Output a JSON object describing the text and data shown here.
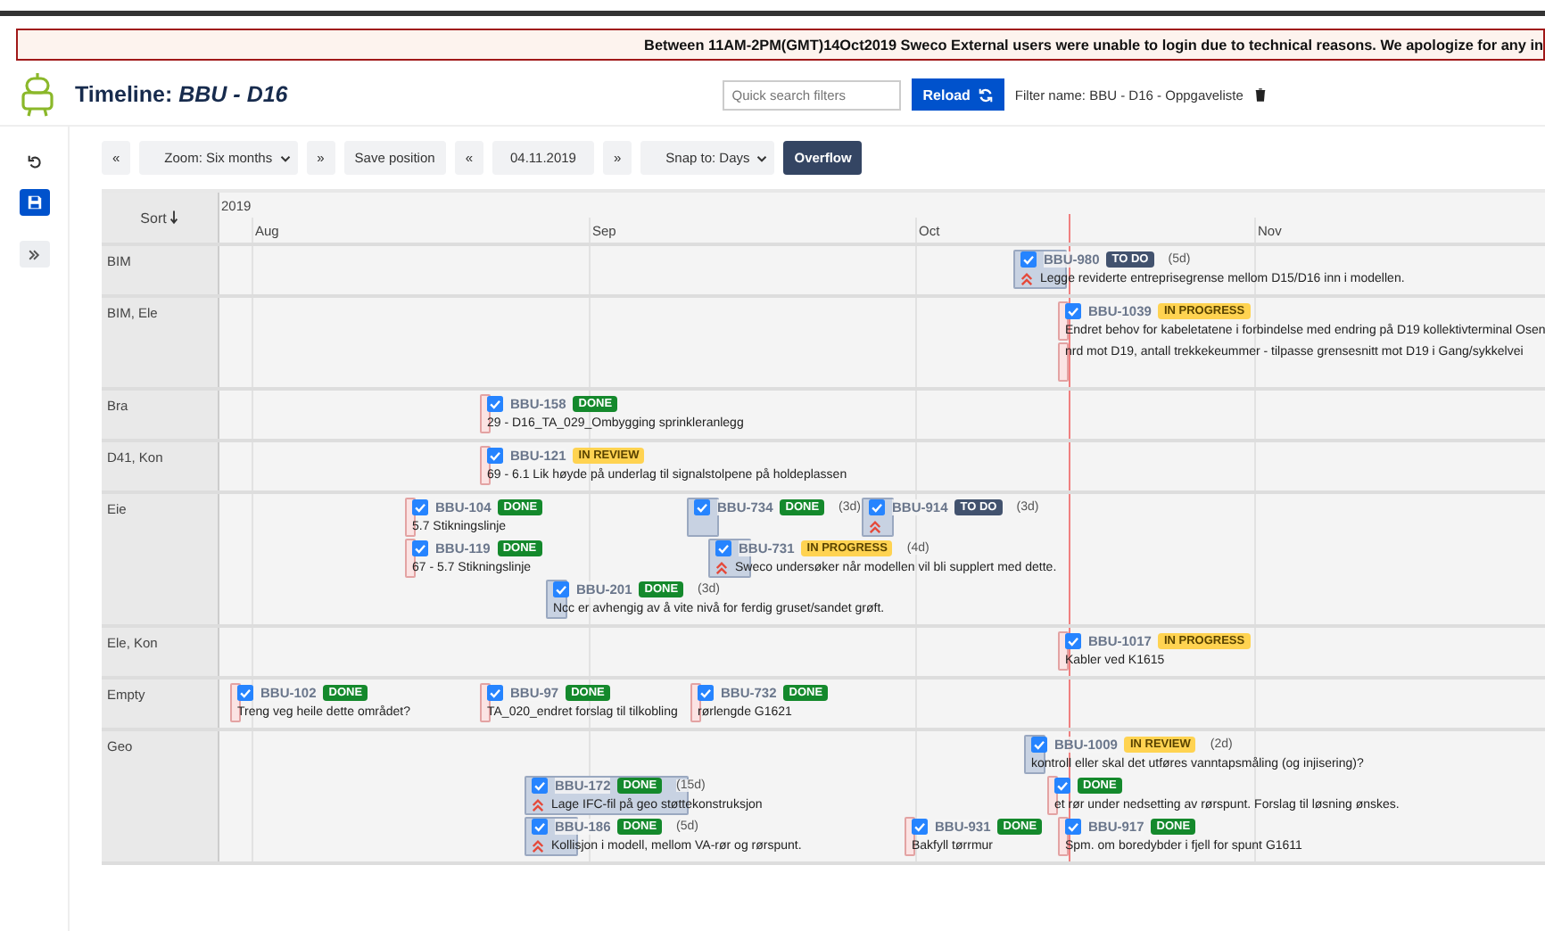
{
  "banner": {
    "text": "Between 11AM-2PM(GMT)14Oct2019 Sweco External users were unable to login due to technical reasons. We apologize for any in"
  },
  "header": {
    "title": "Timeline: *BBU - D16*",
    "search": {
      "placeholder": "Quick search filters"
    },
    "reload": "Reload",
    "filter_name": "Filter name: BBU - D16 - Oppgaveliste"
  },
  "toolbar": [
    {
      "kind": "button",
      "label": "«"
    },
    {
      "kind": "select",
      "label": "Zoom: Six months"
    },
    {
      "kind": "button",
      "label": "»"
    },
    {
      "kind": "button",
      "label": "Save position"
    },
    {
      "kind": "button",
      "label": "«"
    },
    {
      "kind": "field",
      "label": "04.11.2019"
    },
    {
      "kind": "button",
      "label": "»"
    },
    {
      "kind": "select",
      "label": "Snap to: Days"
    },
    {
      "kind": "primary",
      "label": "Overflow"
    }
  ],
  "timeline": {
    "sort": "Sort",
    "year": "2019",
    "months": [
      {
        "label": "Aug"
      },
      {
        "label": "Sep"
      },
      {
        "label": "Oct"
      },
      {
        "label": "Nov"
      }
    ],
    "rows": [
      {
        "label": "BIM",
        "lanes": [
          [
            {
              "key": "BBU-980",
              "status": "TO DO",
              "kind": "todo",
              "duration": "(5d)",
              "high_priority": true,
              "highlighted": true,
              "desc": "Legge reviderte entreprisegrense mellom D15/D16 inn i modellen."
            }
          ]
        ]
      },
      {
        "label": "BIM, Ele",
        "lanes": [
          [
            {
              "key": "BBU-1039",
              "status": "IN PROGRESS",
              "kind": "progress",
              "highlighted": false,
              "desc": "Endret behov for kabeletatene i forbindelse med endring på D19 kollektivterminal Osen"
            }
          ],
          [
            {
              "highlighted": false,
              "desc": "nrd mot D19, antall trekkekeummer - tilpasse grensesnitt mot D19 i Gang/sykkelvei"
            }
          ]
        ]
      },
      {
        "label": "Bra",
        "lanes": [
          [
            {
              "key": "BBU-158",
              "status": "DONE",
              "kind": "done",
              "highlighted": false,
              "desc": "29 - D16_TA_029_Ombygging sprinkleranlegg"
            }
          ]
        ]
      },
      {
        "label": "D41, Kon",
        "lanes": [
          [
            {
              "key": "BBU-121",
              "status": "IN REVIEW",
              "kind": "review",
              "highlighted": false,
              "desc": "69 - 6.1 Lik høyde på underlag til signalstolpene på holdeplassen"
            }
          ]
        ]
      },
      {
        "label": "Eie",
        "lanes": [
          [
            {
              "key": "BBU-104",
              "status": "DONE",
              "kind": "done",
              "highlighted": false,
              "desc": "5.7 Stikningslinje"
            },
            {
              "key": "BBU-734",
              "status": "DONE",
              "kind": "done",
              "duration": "(3d)",
              "highlighted": true
            },
            {
              "key": "BBU-914",
              "status": "TO DO",
              "kind": "todo",
              "duration": "(3d)",
              "high_priority": true,
              "highlighted": true
            }
          ],
          [
            {
              "key": "BBU-119",
              "status": "DONE",
              "kind": "done",
              "highlighted": false,
              "desc": "67 - 5.7 Stikningslinje"
            },
            {
              "key": "BBU-731",
              "status": "IN PROGRESS",
              "kind": "progress",
              "duration": "(4d)",
              "high_priority": true,
              "highlighted": true,
              "desc": "Sweco undersøker når modellen vil bli supplert med dette."
            }
          ],
          [
            {
              "key": "BBU-201",
              "status": "DONE",
              "kind": "done",
              "duration": "(3d)",
              "highlighted": true,
              "desc": "Ncc er avhengig av å vite nivå for ferdig gruset/sandet grøft."
            }
          ]
        ]
      },
      {
        "label": "Ele, Kon",
        "lanes": [
          [
            {
              "key": "BBU-1017",
              "status": "IN PROGRESS",
              "kind": "progress",
              "highlighted": false,
              "desc": "Kabler ved K1615"
            }
          ]
        ]
      },
      {
        "label": "Empty",
        "lanes": [
          [
            {
              "key": "BBU-102",
              "status": "DONE",
              "kind": "done",
              "highlighted": false,
              "desc": "Treng veg heile dette området?"
            },
            {
              "key": "BBU-97",
              "status": "DONE",
              "kind": "done",
              "highlighted": false,
              "desc": "TA_020_endret forslag til tilkobling"
            },
            {
              "key": "BBU-732",
              "status": "DONE",
              "kind": "done",
              "highlighted": false,
              "desc": "rørlengde G1621"
            }
          ]
        ]
      },
      {
        "label": "Geo",
        "lanes": [
          [
            {
              "key": "BBU-1009",
              "status": "IN REVIEW",
              "kind": "review",
              "duration": "(2d)",
              "highlighted": true,
              "desc": "kontroll eller skal det utføres vanntapsmåling (og injisering)?"
            }
          ],
          [
            {
              "key": "BBU-172",
              "status": "DONE",
              "kind": "done",
              "duration": "(15d)",
              "high_priority": true,
              "highlighted": true,
              "desc": "Lage IFC-fil på geo støttekonstruksjon"
            },
            {
              "status": "DONE",
              "kind": "done",
              "highlighted": false,
              "desc": "et rør under nedsetting av rørspunt. Forslag til løsning ønskes."
            }
          ],
          [
            {
              "key": "BBU-186",
              "status": "DONE",
              "kind": "done",
              "duration": "(5d)",
              "high_priority": true,
              "highlighted": true,
              "desc": "Kollisjon i modell, mellom VA-rør og rørspunt."
            },
            {
              "key": "BBU-931",
              "status": "DONE",
              "kind": "done",
              "highlighted": false,
              "desc": "Bakfyll tørrmur"
            },
            {
              "key": "BBU-917",
              "status": "DONE",
              "kind": "done",
              "highlighted": false,
              "desc": "Spm. om boredybder i fjell for spunt G1611"
            }
          ]
        ]
      }
    ]
  }
}
